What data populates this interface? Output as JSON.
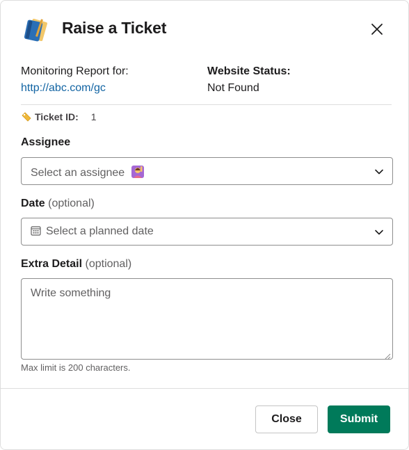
{
  "header": {
    "title": "Raise a Ticket",
    "icon": "blue-notebook-icon",
    "close_icon": "close-icon"
  },
  "report": {
    "label": "Monitoring Report for:",
    "url": "http://abc.com/gc",
    "status_label": "Website Status:",
    "status_value": "Not Found"
  },
  "ticket": {
    "icon": "tag-icon",
    "label": "Ticket ID:",
    "value": "1"
  },
  "assignee": {
    "label": "Assignee",
    "placeholder": "Select an assignee",
    "emoji": "person-raising-hand-icon"
  },
  "date": {
    "label": "Date",
    "optional": "(optional)",
    "placeholder": "Select a planned date"
  },
  "extra_detail": {
    "label": "Extra Detail",
    "optional": "(optional)",
    "placeholder": "Write something",
    "hint": "Max limit is 200 characters."
  },
  "footer": {
    "close_label": "Close",
    "submit_label": "Submit"
  },
  "colors": {
    "link": "#1264a3",
    "submit": "#007a5a",
    "border": "#8d8d8d"
  }
}
